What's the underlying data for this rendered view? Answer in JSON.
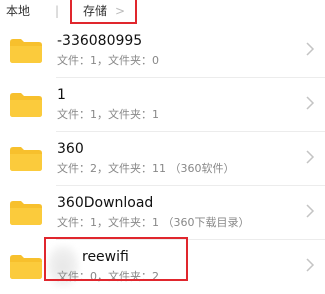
{
  "breadcrumb": {
    "root": "本地",
    "separator": "|",
    "current": "存储",
    "arrow": ">"
  },
  "rows": [
    {
      "name": "-336080995",
      "meta": "文件：1，文件夹：0"
    },
    {
      "name": "1",
      "meta": "文件：1，文件夹：1"
    },
    {
      "name": "360",
      "meta": "文件：2，文件夹：11 （360软件）"
    },
    {
      "name": "360Download",
      "meta": "文件：1，文件夹：1 （360下载目录）"
    },
    {
      "name": "reewifi",
      "meta": "文件：0，文件夹：2"
    }
  ],
  "icons": {
    "folder": "folder-icon",
    "chevron": "chevron-right-icon"
  },
  "colors": {
    "folder": "#f7c02d",
    "highlight": "#e0262d"
  }
}
